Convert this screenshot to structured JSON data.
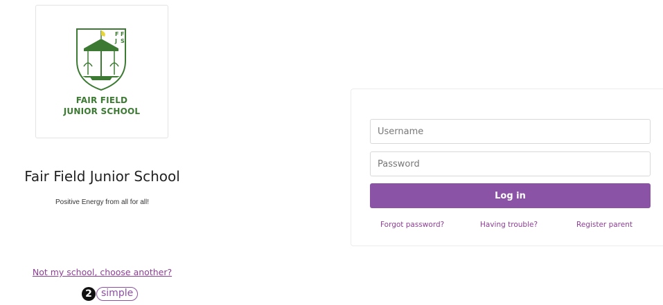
{
  "school": {
    "logo_line1": "FAIR FIELD",
    "logo_line2": "JUNIOR SCHOOL",
    "crest_letters": [
      "F",
      "F",
      "J",
      "S"
    ],
    "name": "Fair Field Junior School",
    "motto": "Positive Energy from all for all!"
  },
  "links": {
    "not_my_school": "Not my school, choose another?"
  },
  "brand": {
    "number": "2",
    "word": "simple"
  },
  "login": {
    "username_placeholder": "Username",
    "password_placeholder": "Password",
    "submit_label": "Log in",
    "forgot_password": "Forgot password?",
    "having_trouble": "Having trouble?",
    "register_parent": "Register parent"
  },
  "colors": {
    "accent": "#8b53a5",
    "link": "#8d3f95",
    "logo_green": "#3c7a33",
    "crest_yellow": "#e6d53a"
  }
}
